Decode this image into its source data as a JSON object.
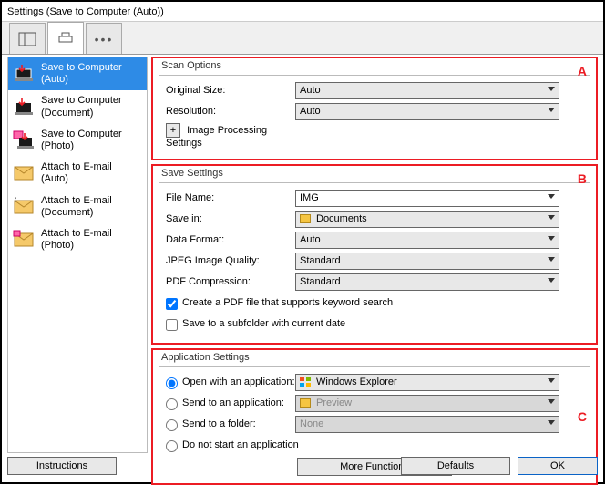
{
  "window": {
    "title": "Settings (Save to Computer (Auto))"
  },
  "tabs": {
    "selected_index": 1
  },
  "sidebar": {
    "items": [
      {
        "label": "Save to Computer (Auto)"
      },
      {
        "label": "Save to Computer (Document)"
      },
      {
        "label": "Save to Computer (Photo)"
      },
      {
        "label": "Attach to E-mail (Auto)"
      },
      {
        "label": "Attach to E-mail (Document)"
      },
      {
        "label": "Attach to E-mail (Photo)"
      }
    ]
  },
  "scan": {
    "legend": "Scan Options",
    "original_size_label": "Original Size:",
    "original_size_value": "Auto",
    "resolution_label": "Resolution:",
    "resolution_value": "Auto",
    "image_processing": "Image Processing Settings",
    "letter": "A"
  },
  "save": {
    "legend": "Save Settings",
    "filename_label": "File Name:",
    "filename_value": "IMG",
    "savein_label": "Save in:",
    "savein_value": "Documents",
    "dataformat_label": "Data Format:",
    "dataformat_value": "Auto",
    "jpeg_label": "JPEG Image Quality:",
    "jpeg_value": "Standard",
    "pdfc_label": "PDF Compression:",
    "pdfc_value": "Standard",
    "cb1": "Create a PDF file that supports keyword search",
    "cb2": "Save to a subfolder with current date",
    "letter": "B"
  },
  "app": {
    "legend": "Application Settings",
    "r1": "Open with an application:",
    "r1_value": "Windows Explorer",
    "r2": "Send to an application:",
    "r2_value": "Preview",
    "r3": "Send to a folder:",
    "r3_value": "None",
    "r4": "Do not start an application",
    "more": "More Functions",
    "letter": "C"
  },
  "footer": {
    "instructions": "Instructions",
    "defaults": "Defaults",
    "ok": "OK"
  }
}
